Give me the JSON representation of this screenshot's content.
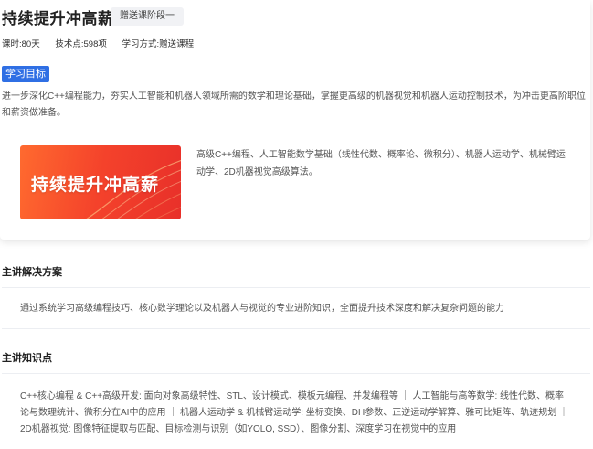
{
  "course": {
    "title": "持续提升冲高薪",
    "stage_button": "赠送课阶段一",
    "meta": {
      "hours": "课时:80天",
      "points": "技术点:598项",
      "mode": "学习方式:赠送课程"
    },
    "goal_tag": "学习目标",
    "goal_text": "进一步深化C++编程能力，夯实人工智能和机器人领域所需的数学和理论基础，掌握更高级的机器视觉和机器人运动控制技术，为冲击更高阶职位和薪资做准备。",
    "banner_text": "持续提升冲高薪",
    "description": "高级C++编程、人工智能数学基础（线性代数、概率论、微积分）、机器人运动学、机械臂运动学、2D机器视觉高级算法。"
  },
  "solution": {
    "title": "主讲解决方案",
    "text": "通过系统学习高级编程技巧、核心数学理论以及机器人与视觉的专业进阶知识，全面提升技术深度和解决复杂问题的能力"
  },
  "knowledge": {
    "title": "主讲知识点",
    "text": "C++核心编程 & C++高级开发: 面向对象高级特性、STL、设计模式、模板元编程、并发编程等 ｜ 人工智能与高等数学: 线性代数、概率论与数理统计、微积分在AI中的应用 ｜ 机器人运动学 & 机械臂运动学: 坐标变换、DH参数、正逆运动学解算、雅可比矩阵、轨迹规划 ｜ 2D机器视觉: 图像特征提取与匹配、目标检测与识别（如YOLO, SSD）、图像分割、深度学习在视觉中的应用"
  },
  "colors": {
    "accent": "#2f6fe4",
    "banner_from": "#ff6a2f",
    "banner_to": "#e8302a"
  }
}
